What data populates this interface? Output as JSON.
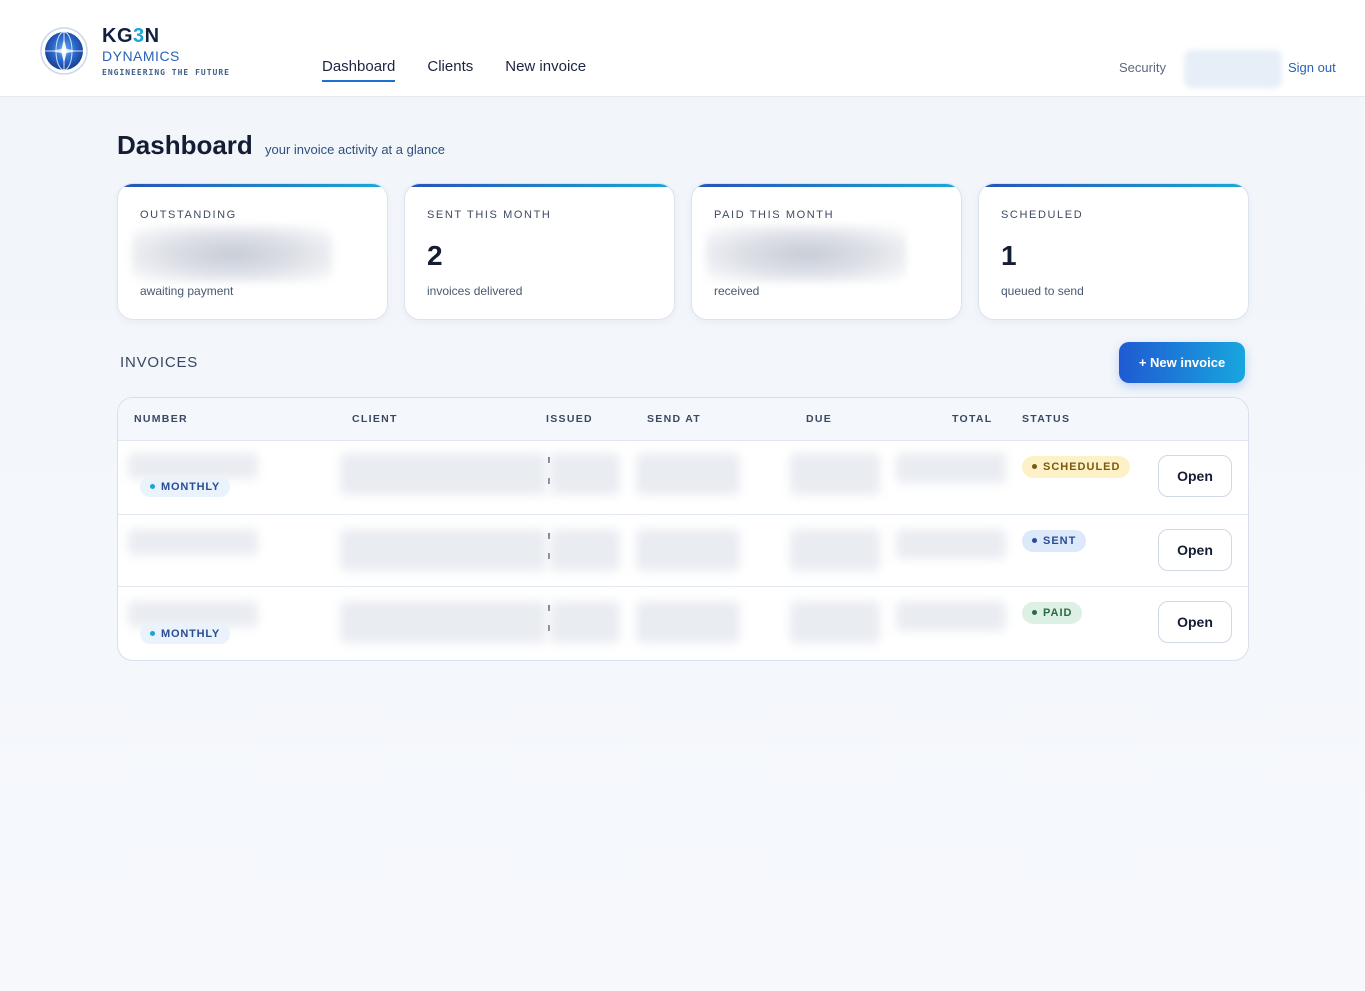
{
  "brand": {
    "name_prefix": "KG",
    "name_accent": "3",
    "name_suffix": "N",
    "sub": "DYNAMICS",
    "tagline": "ENGINEERING THE FUTURE",
    "logo_icon": "globe-compass-icon"
  },
  "nav": {
    "items": [
      {
        "label": "Dashboard",
        "active": true
      },
      {
        "label": "Clients",
        "active": false
      },
      {
        "label": "New invoice",
        "active": false
      }
    ]
  },
  "header_right": {
    "security": "Security",
    "sign_out": "Sign out"
  },
  "page": {
    "title": "Dashboard",
    "subtitle": "your invoice activity at a glance"
  },
  "cards": [
    {
      "label": "OUTSTANDING",
      "value": "",
      "footer": "awaiting payment",
      "value_blurred": true
    },
    {
      "label": "SENT THIS MONTH",
      "value": "2",
      "footer": "invoices delivered",
      "value_blurred": false
    },
    {
      "label": "PAID THIS MONTH",
      "value": "",
      "footer": "received",
      "value_blurred": true
    },
    {
      "label": "SCHEDULED",
      "value": "1",
      "footer": "queued to send",
      "value_blurred": false
    }
  ],
  "invoices": {
    "section_title": "INVOICES",
    "new_button": "+ New invoice",
    "columns": [
      "NUMBER",
      "CLIENT",
      "ISSUED",
      "SEND AT",
      "DUE",
      "TOTAL",
      "STATUS"
    ],
    "rows": [
      {
        "tag": "MONTHLY",
        "status": "SCHEDULED",
        "status_kind": "scheduled",
        "action": "Open"
      },
      {
        "tag": "",
        "status": "SENT",
        "status_kind": "sent",
        "action": "Open"
      },
      {
        "tag": "MONTHLY",
        "status": "PAID",
        "status_kind": "paid",
        "action": "Open"
      }
    ]
  },
  "colors": {
    "accent": "#1f5ad2",
    "accent_end": "#18a6de",
    "scheduled_bg": "#fdf1c8",
    "sent_bg": "#dbe9fb",
    "paid_bg": "#dcf1e4"
  }
}
